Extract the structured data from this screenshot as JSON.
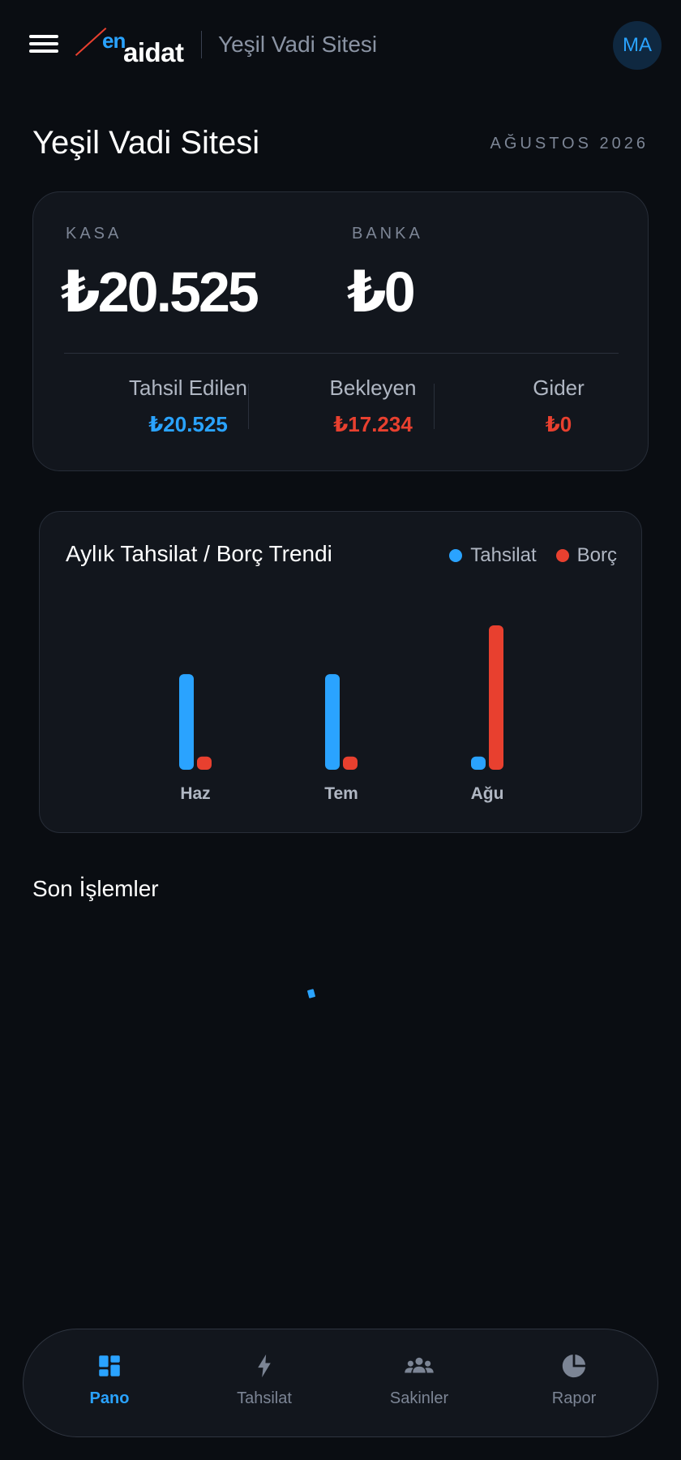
{
  "header": {
    "logo_en": "en",
    "logo_aidat": "aidat",
    "site_name": "Yeşil Vadi Sitesi",
    "avatar_initials": "MA"
  },
  "page": {
    "title": "Yeşil Vadi Sitesi",
    "period": "AĞUSTOS 2026"
  },
  "balances": {
    "kasa_label": "KASA",
    "kasa_value": "₺20.525",
    "banka_label": "BANKA",
    "banka_value": "₺0"
  },
  "stats": {
    "collected_label": "Tahsil Edilen",
    "collected_value": "₺20.525",
    "pending_label": "Bekleyen",
    "pending_value": "₺17.234",
    "expense_label": "Gider",
    "expense_value": "₺0"
  },
  "colors": {
    "accent_blue": "#2aa3ff",
    "accent_red": "#e8402f",
    "background": "#0a0d12",
    "card": "#12161d"
  },
  "chart_data": {
    "type": "bar",
    "title": "Aylık Tahsilat / Borç Trendi",
    "categories": [
      "Haz",
      "Tem",
      "Ağu"
    ],
    "series": [
      {
        "name": "Tahsilat",
        "values": [
          20525,
          20525,
          600
        ]
      },
      {
        "name": "Borç",
        "values": [
          1500,
          1500,
          31000
        ]
      }
    ],
    "ylim": [
      0,
      31000
    ],
    "grid": false,
    "legend": "top-right"
  },
  "recent": {
    "title": "Son İşlemler"
  },
  "nav": {
    "items": [
      {
        "label": "Pano",
        "icon": "dashboard-icon",
        "active": true
      },
      {
        "label": "Tahsilat",
        "icon": "bolt-icon",
        "active": false
      },
      {
        "label": "Sakinler",
        "icon": "people-icon",
        "active": false
      },
      {
        "label": "Rapor",
        "icon": "pie-chart-icon",
        "active": false
      }
    ]
  }
}
